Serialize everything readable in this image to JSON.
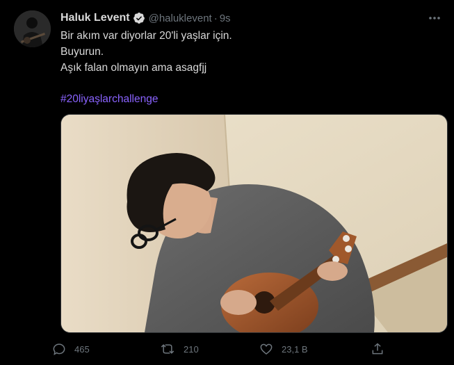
{
  "tweet": {
    "author": {
      "display_name": "Haluk Levent",
      "handle": "@haluklevent",
      "verified_icon": "verified-badge-icon"
    },
    "separator": "·",
    "timestamp": "9s",
    "text_lines": [
      "Bir akım var diyorlar 20'li yaşlar için.",
      "Buyurun.",
      "Aşık falan olmayın ama asagfjj"
    ],
    "hashtag": "#20liyaşlarchallenge",
    "actions": {
      "reply_count": "465",
      "retweet_count": "210",
      "like_count": "23,1 B"
    }
  },
  "colors": {
    "background": "#000000",
    "text_primary": "#d9d9d9",
    "text_secondary": "#6e767d",
    "hashtag": "#8a63ff",
    "border": "#2f3336"
  }
}
